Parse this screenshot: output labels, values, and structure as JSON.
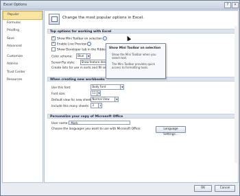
{
  "window": {
    "title": "Excel Options"
  },
  "sidebar": {
    "items": [
      "Popular",
      "Formulas",
      "Proofing",
      "Save",
      "Advanced",
      "Customize",
      "Add-Ins",
      "Trust Center",
      "Resources"
    ]
  },
  "header": {
    "text": "Change the most popular options in Excel."
  },
  "sections": {
    "top": "Top options for working with Excel",
    "new_wb": "When creating new workbooks",
    "personalize": "Personalize your copy of Microsoft Office"
  },
  "top_options": {
    "mini_toolbar": "Show Mini Toolbar on selection",
    "live_preview": "Enable Live Preview",
    "developer": "Show Developer tab in the Ribbon",
    "color_scheme_label": "Color scheme:",
    "color_scheme_value": "Blue",
    "screentip_label": "ScreenTip style:",
    "screentip_value": "Show feature desc",
    "create_lists": "Create lists for use in sorts and fill se"
  },
  "tooltip": {
    "title": "Show Mini Toolbar on selection",
    "line1": "Show the Mini Toolbar when you",
    "line2": "select text.",
    "line3": "The Mini Toolbar provides quick",
    "line4": "access to formatting tools."
  },
  "new_workbook": {
    "font_label": "Use this font:",
    "font_value": "Body Font",
    "size_label": "Font size:",
    "size_value": "11",
    "view_label": "Default view for new sheets:",
    "view_value": "Normal View",
    "sheets_label": "Include this many sheets:",
    "sheets_value": "3"
  },
  "personalize": {
    "user_label": "User name:",
    "user_value": "Mark",
    "lang_text": "Choose the languages you want to use with Microsoft Office:",
    "lang_button": "Language Settings..."
  },
  "footer": {
    "ok": "OK",
    "cancel": "Cancel"
  }
}
